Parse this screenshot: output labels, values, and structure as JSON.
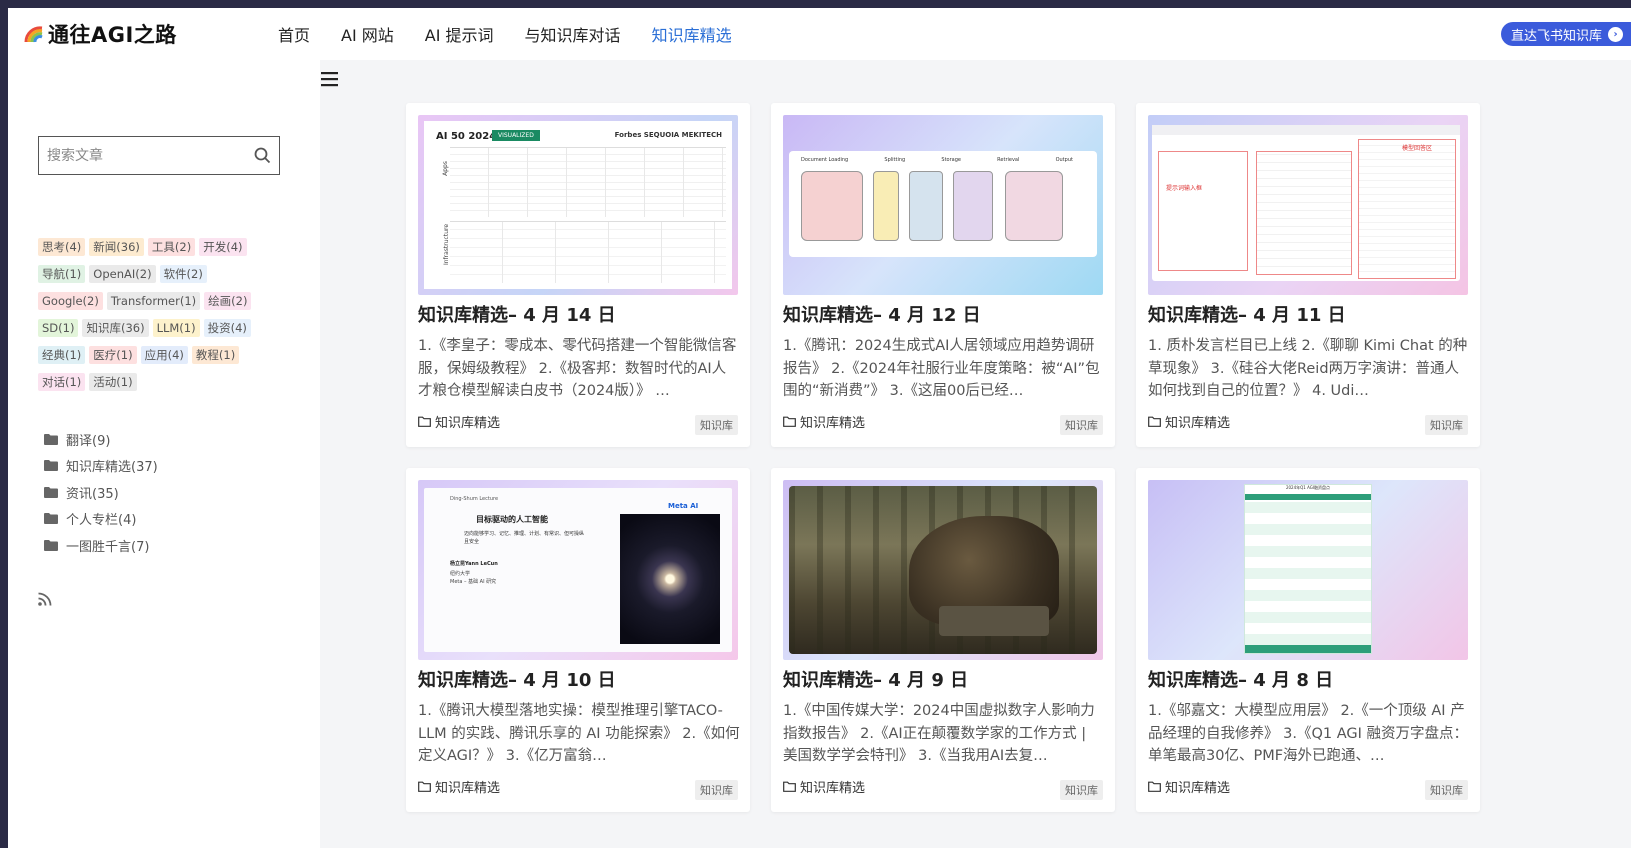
{
  "brand": {
    "name": "通往AGI之路",
    "logo_icon": "rainbow-logo-icon"
  },
  "nav": {
    "items": [
      {
        "label": "首页",
        "active": false
      },
      {
        "label": "AI 网站",
        "active": false
      },
      {
        "label": "AI 提示词",
        "active": false
      },
      {
        "label": "与知识库对话",
        "active": false
      },
      {
        "label": "知识库精选",
        "active": true
      }
    ],
    "cta_label": "直达飞书知识库"
  },
  "search": {
    "placeholder": "搜索文章",
    "value": ""
  },
  "tags": [
    {
      "label": "思考(4)",
      "color": "#fde8d4"
    },
    {
      "label": "新闻(36)",
      "color": "#fdebd0"
    },
    {
      "label": "工具(2)",
      "color": "#fde0e0"
    },
    {
      "label": "开发(4)",
      "color": "#fbe3f0"
    },
    {
      "label": "导航(1)",
      "color": "#e0f2e4"
    },
    {
      "label": "OpenAI(2)",
      "color": "#eaeaea"
    },
    {
      "label": "软件(2)",
      "color": "#e6f0fb"
    },
    {
      "label": "Google(2)",
      "color": "#fde0e0"
    },
    {
      "label": "Transformer(1)",
      "color": "#eaeaea"
    },
    {
      "label": "绘画(2)",
      "color": "#fbe3f0"
    },
    {
      "label": "SD(1)",
      "color": "#e3f5da"
    },
    {
      "label": "知识库(36)",
      "color": "#eaeaea"
    },
    {
      "label": "LLM(1)",
      "color": "#fdf2cc"
    },
    {
      "label": "投资(4)",
      "color": "#e6f0fb"
    },
    {
      "label": "经典(1)",
      "color": "#dff0f5"
    },
    {
      "label": "医疗(1)",
      "color": "#fde0e0"
    },
    {
      "label": "应用(4)",
      "color": "#e3ecfb"
    },
    {
      "label": "教程(1)",
      "color": "#fde8d4"
    },
    {
      "label": "对话(1)",
      "color": "#fbe3f0"
    },
    {
      "label": "活动(1)",
      "color": "#eaeaea"
    }
  ],
  "categories": [
    {
      "label": "翻译(9)"
    },
    {
      "label": "知识库精选(37)"
    },
    {
      "label": "资讯(35)"
    },
    {
      "label": "个人专栏(4)"
    },
    {
      "label": "一图胜千言(7)"
    }
  ],
  "cards": [
    {
      "title": "知识库精选– 4 月 14 日",
      "excerpt": "1.《李皇子：零成本、零代码搭建一个智能微信客服，保姆级教程》 2.《极客邦：数智时代的AI人才粮仓模型解读白皮书（2024版）》 …",
      "category": "知识库精选",
      "tag": "知识库",
      "thumb": "ai50-chart-thumbnail",
      "thumb_text": {
        "title": "AI 50 2024",
        "badge": "VISUALIZED",
        "brands": "Forbes  SEQUOIA  MEKITECH",
        "row1": "Apps",
        "row2": "Infrastructure"
      }
    },
    {
      "title": "知识库精选– 4 月 12 日",
      "excerpt": "1.《腾讯：2024生成式AI人居领域应用趋势调研报告》 2.《2024年社服行业年度策略：被“AI”包围的“新消费”》 3.《这届00后已经…",
      "category": "知识库精选",
      "tag": "知识库",
      "thumb": "rag-pipeline-diagram-thumbnail",
      "thumb_text": {
        "steps": [
          "Document Loading",
          "Splitting",
          "Storage",
          "Retrieval",
          "Output"
        ]
      }
    },
    {
      "title": "知识库精选– 4 月 11 日",
      "excerpt": "1. 质朴发言栏目已上线 2.《聊聊 Kimi Chat 的种草现象》 3.《硅谷大佬Reid两万字演讲：普通人如何找到自己的位置？》 4. Udi…",
      "category": "知识库精选",
      "tag": "知识库",
      "thumb": "app-screenshot-thumbnail",
      "thumb_text": {
        "left": "提示词输入框",
        "right": "模型回答区"
      }
    },
    {
      "title": "知识库精选– 4 月 10 日",
      "excerpt": "1.《腾讯大模型落地实操：模型推理引擎TACO-LLM 的实践、腾讯乐享的 AI 功能探索》 2.《如何定义AGI？》 3.《亿万富翁…",
      "category": "知识库精选",
      "tag": "知识库",
      "thumb": "lecture-slide-thumbnail",
      "thumb_text": {
        "header": "Ding-Shum Lecture",
        "heading": "目标驱动的人工智能",
        "sub": "迈向能够学习、记忆、推理、计划、有常识、但可操纵且安全",
        "author": "杨立昆Yann LeCun",
        "org": "纽约大学",
        "org2": "Meta – 基础 AI 研究",
        "brand": "Meta AI"
      }
    },
    {
      "title": "知识库精选– 4 月 9 日",
      "excerpt": "1.《中国传媒大学：2024中国虚拟数字人影响力指数报告》 2.《AI正在颠覆数学家的工作方式 | 美国数学学会特刊》 3.《当我用AI去复…",
      "category": "知识库精选",
      "tag": "知识库",
      "thumb": "dragon-forest-image-thumbnail",
      "thumb_text": {}
    },
    {
      "title": "知识库精选– 4 月 8 日",
      "excerpt": "1.《邬嘉文：大模型应用层》 2.《一个顶级 AI 产品经理的自我修养》 3.《Q1 AGI 融资万字盘点：单笔最高30亿、PMF海外已跑通、…",
      "category": "知识库精选",
      "tag": "知识库",
      "thumb": "funding-table-thumbnail",
      "thumb_text": {
        "heading": "2024年Q1 AGI融资盘点"
      }
    }
  ],
  "icons": {
    "search": "search-icon",
    "menu": "hamburger-menu-icon",
    "rss": "rss-icon",
    "folder": "folder-icon",
    "arrow": "arrow-right-circle-icon"
  },
  "colors": {
    "accent": "#2b6fd6",
    "cta": "#3b5bdb"
  }
}
